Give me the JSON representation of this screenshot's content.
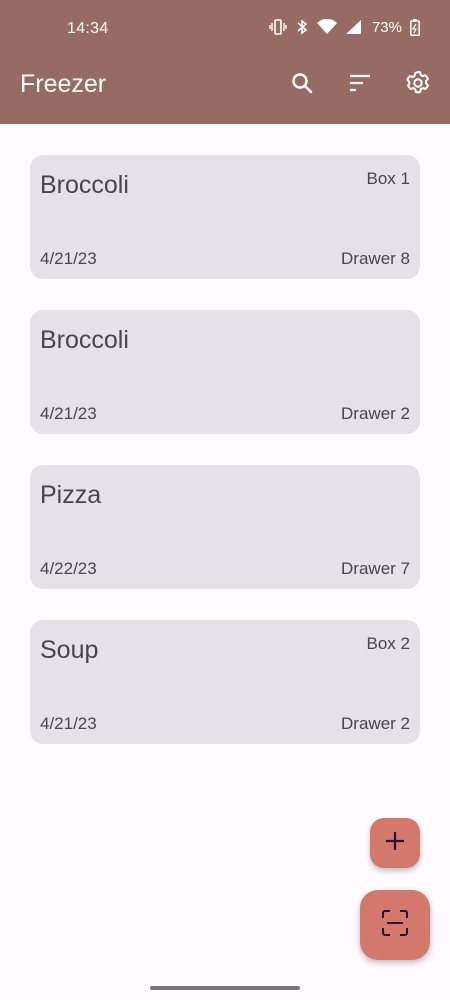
{
  "status_bar": {
    "time": "14:34",
    "battery_percent": "73%",
    "icons": [
      "vibrate-icon",
      "bluetooth-icon",
      "wifi-icon",
      "signal-icon",
      "battery-icon"
    ]
  },
  "app_bar": {
    "title": "Freezer",
    "actions": [
      "search-icon",
      "sort-icon",
      "gear-icon"
    ]
  },
  "items": [
    {
      "name": "Broccoli",
      "box": "Box 1",
      "date": "4/21/23",
      "drawer": "Drawer 8"
    },
    {
      "name": "Broccoli",
      "box": "",
      "date": "4/21/23",
      "drawer": "Drawer 2"
    },
    {
      "name": "Pizza",
      "box": "",
      "date": "4/22/23",
      "drawer": "Drawer 7"
    },
    {
      "name": "Soup",
      "box": "Box 2",
      "date": "4/21/23",
      "drawer": "Drawer 2"
    }
  ],
  "fabs": {
    "add": "plus-icon",
    "scan": "scan-icon"
  },
  "colors": {
    "app_bar": "#976b64",
    "card": "#e6e0e9",
    "fab": "#d4776d",
    "background": "#fffbfe"
  }
}
